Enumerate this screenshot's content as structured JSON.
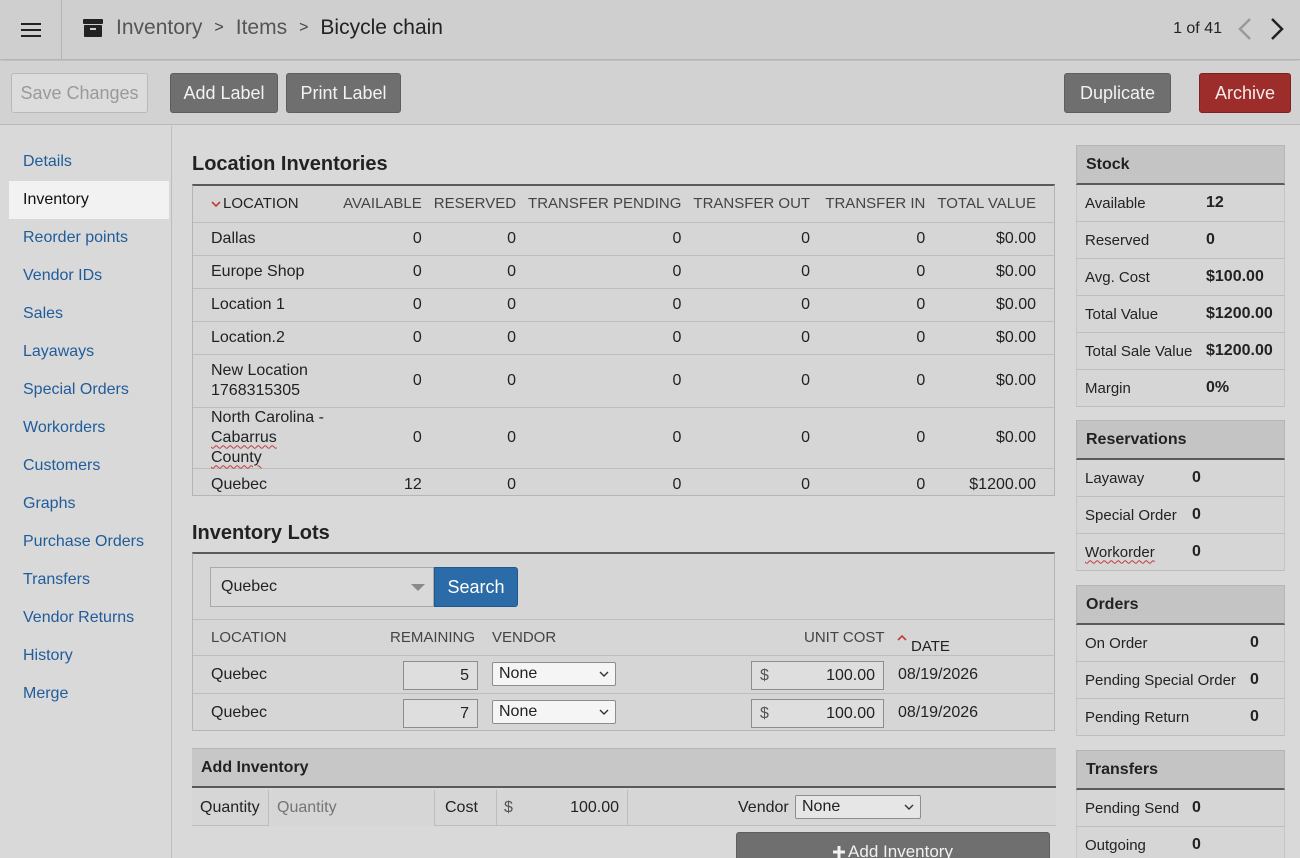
{
  "header": {
    "breadcrumbs": [
      "Inventory",
      "Items",
      "Bicycle chain"
    ],
    "separator": ">",
    "pager": "1 of 41"
  },
  "toolbar": {
    "save_label": "Save Changes",
    "add_label": "Add Label",
    "print_label": "Print Label",
    "duplicate_label": "Duplicate",
    "archive_label": "Archive"
  },
  "sidebar": {
    "items": [
      {
        "label": "Details"
      },
      {
        "label": "Inventory"
      },
      {
        "label": "Reorder points"
      },
      {
        "label": "Vendor IDs"
      },
      {
        "label": "Sales"
      },
      {
        "label": "Layaways"
      },
      {
        "label": "Special Orders"
      },
      {
        "label": "Workorders"
      },
      {
        "label": "Customers"
      },
      {
        "label": "Graphs"
      },
      {
        "label": "Purchase Orders"
      },
      {
        "label": "Transfers"
      },
      {
        "label": "Vendor Returns"
      },
      {
        "label": "History"
      },
      {
        "label": "Merge"
      }
    ],
    "active_index": 1
  },
  "location_inventories": {
    "title": "Location Inventories",
    "columns": [
      "LOCATION",
      "AVAILABLE",
      "RESERVED",
      "TRANSFER PENDING",
      "TRANSFER OUT",
      "TRANSFER IN",
      "TOTAL VALUE"
    ],
    "rows": [
      {
        "location": "Dallas",
        "available": "0",
        "reserved": "0",
        "transfer_pending": "0",
        "transfer_out": "0",
        "transfer_in": "0",
        "total_value": "$0.00"
      },
      {
        "location": "Europe Shop",
        "available": "0",
        "reserved": "0",
        "transfer_pending": "0",
        "transfer_out": "0",
        "transfer_in": "0",
        "total_value": "$0.00"
      },
      {
        "location": "Location 1",
        "available": "0",
        "reserved": "0",
        "transfer_pending": "0",
        "transfer_out": "0",
        "transfer_in": "0",
        "total_value": "$0.00"
      },
      {
        "location": "Location.2",
        "available": "0",
        "reserved": "0",
        "transfer_pending": "0",
        "transfer_out": "0",
        "transfer_in": "0",
        "total_value": "$0.00"
      },
      {
        "location_line1": "New Location",
        "location_line2": "1768315305",
        "available": "0",
        "reserved": "0",
        "transfer_pending": "0",
        "transfer_out": "0",
        "transfer_in": "0",
        "total_value": "$0.00"
      },
      {
        "location_line1": "North Carolina -",
        "location_line2": "Cabarrus County",
        "available": "0",
        "reserved": "0",
        "transfer_pending": "0",
        "transfer_out": "0",
        "transfer_in": "0",
        "total_value": "$0.00"
      },
      {
        "location": "Quebec",
        "available": "12",
        "reserved": "0",
        "transfer_pending": "0",
        "transfer_out": "0",
        "transfer_in": "0",
        "total_value": "$1200.00"
      }
    ]
  },
  "inventory_lots": {
    "title": "Inventory Lots",
    "location_select": "Quebec",
    "search_label": "Search",
    "columns": [
      "LOCATION",
      "REMAINING",
      "VENDOR",
      "UNIT COST",
      "DATE"
    ],
    "rows": [
      {
        "location": "Quebec",
        "remaining": "5",
        "vendor": "None",
        "currency": "$",
        "unit_cost": "100.00",
        "date": "08/19/2026"
      },
      {
        "location": "Quebec",
        "remaining": "7",
        "vendor": "None",
        "currency": "$",
        "unit_cost": "100.00",
        "date": "08/19/2026"
      }
    ]
  },
  "add_inventory": {
    "title": "Add Inventory",
    "quantity_label": "Quantity",
    "quantity_placeholder": "Quantity",
    "cost_label": "Cost",
    "currency": "$",
    "cost_value": "100.00",
    "vendor_label": "Vendor",
    "vendor_value": "None",
    "button_label": "Add Inventory"
  },
  "stock": {
    "title": "Stock",
    "rows": [
      {
        "label": "Available",
        "value": "12"
      },
      {
        "label": "Reserved",
        "value": "0"
      },
      {
        "label": "Avg. Cost",
        "value": "$100.00"
      },
      {
        "label": "Total Value",
        "value": "$1200.00"
      },
      {
        "label": "Total Sale Value",
        "value": "$1200.00"
      },
      {
        "label": "Margin",
        "value": "0%"
      }
    ]
  },
  "reservations": {
    "title": "Reservations",
    "rows": [
      {
        "label": "Layaway",
        "value": "0"
      },
      {
        "label": "Special Order",
        "value": "0"
      },
      {
        "label": "Workorder",
        "value": "0"
      }
    ]
  },
  "orders": {
    "title": "Orders",
    "rows": [
      {
        "label": "On Order",
        "value": "0"
      },
      {
        "label": "Pending Special Order",
        "value": "0"
      },
      {
        "label": "Pending Return",
        "value": "0"
      }
    ]
  },
  "transfers": {
    "title": "Transfers",
    "rows": [
      {
        "label": "Pending Send",
        "value": "0"
      },
      {
        "label": "Outgoing",
        "value": "0"
      }
    ]
  },
  "colors": {
    "link": "#1f5c9a",
    "search_button": "#2b6ca8",
    "archive_button": "#9c2d2a",
    "dark_button": "#6f6f6f",
    "sort_arrow": "#c43b3b"
  },
  "icons": [
    "hamburger-menu-icon",
    "archive-box-icon",
    "chevron-left-icon",
    "chevron-right-icon",
    "sort-desc-icon",
    "sort-asc-icon",
    "plus-icon"
  ]
}
